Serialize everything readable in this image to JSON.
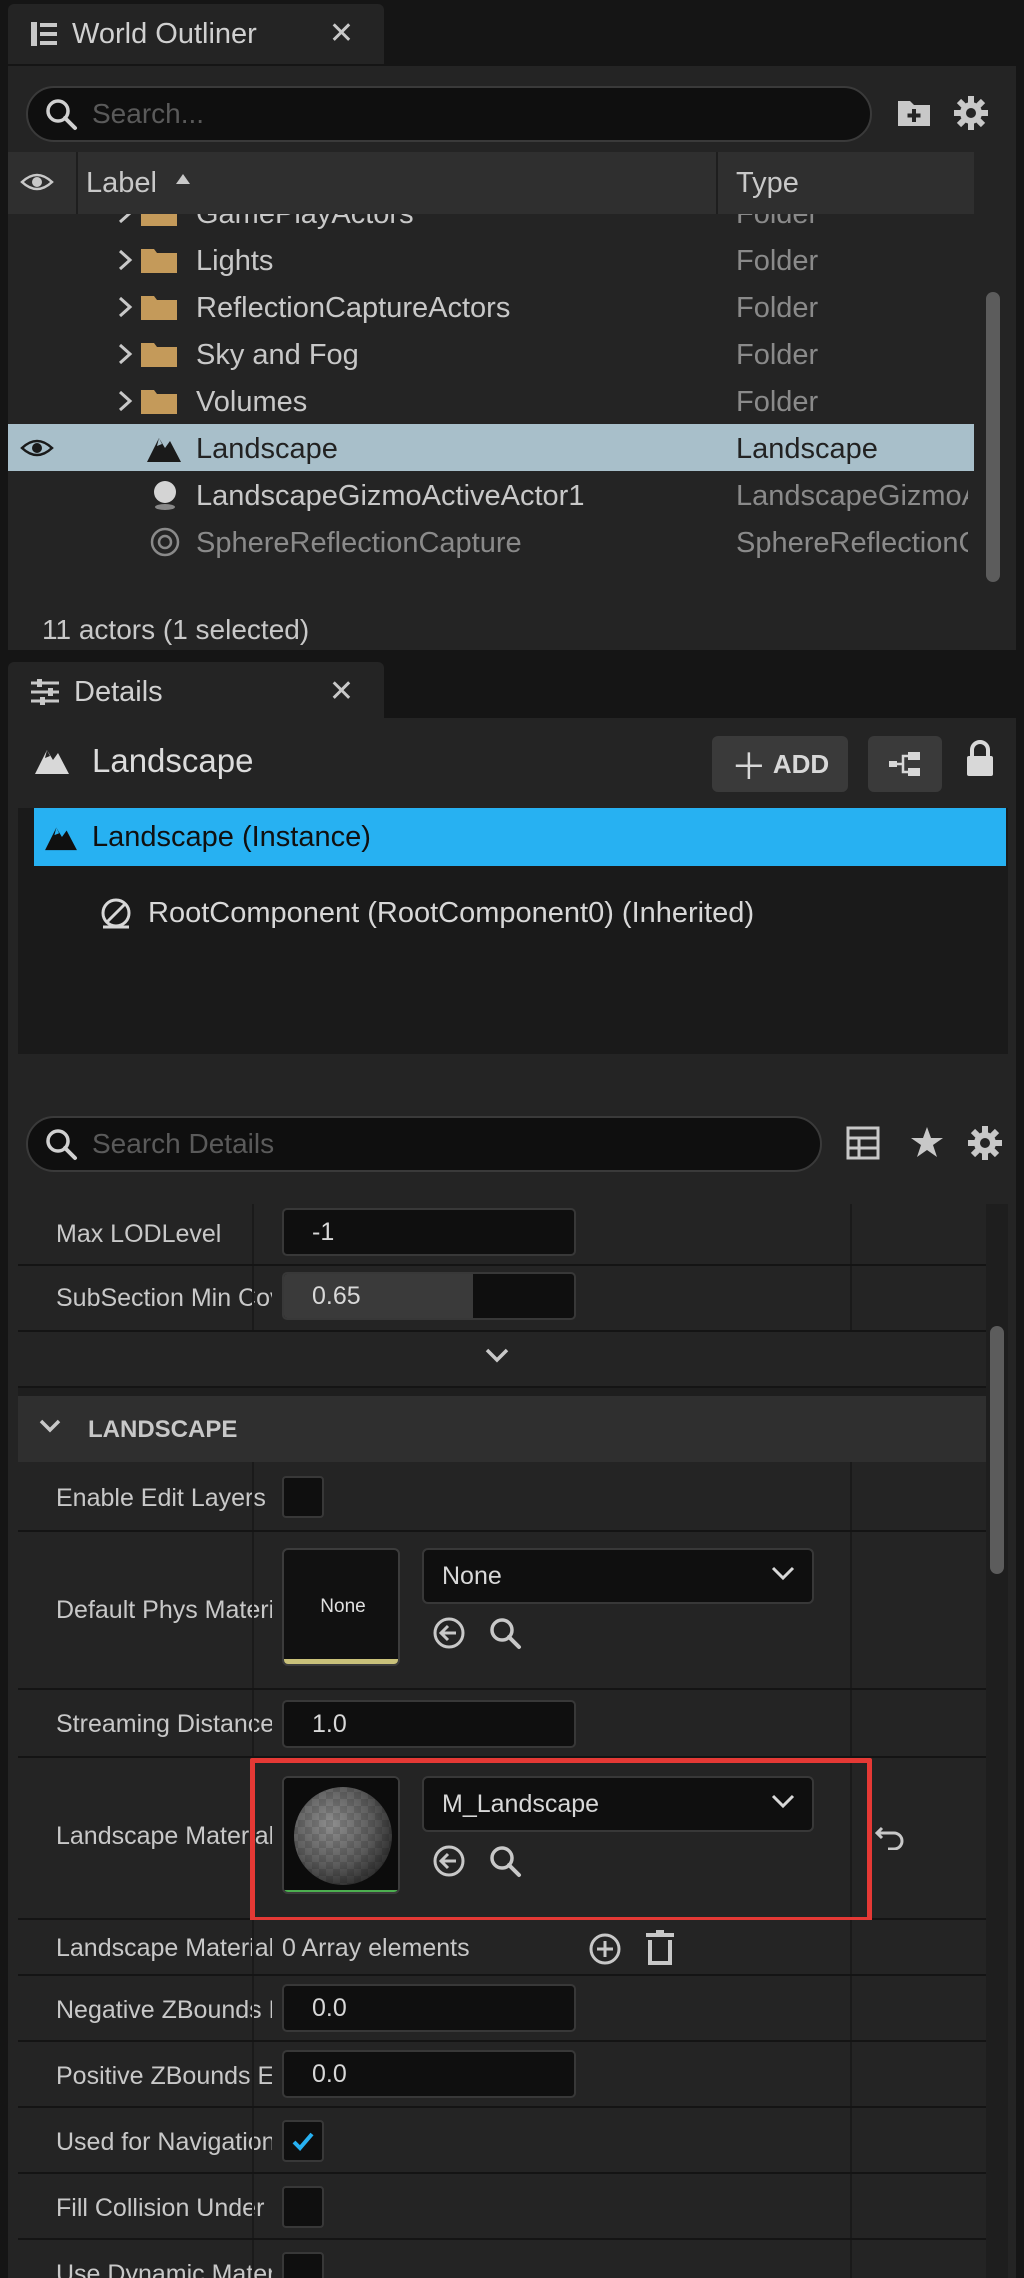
{
  "outliner": {
    "tab_title": "World Outliner",
    "search_placeholder": "Search...",
    "col_label": "Label",
    "col_type": "Type",
    "rows": [
      {
        "label": "GamePlayActors",
        "type": "Folder",
        "kind": "folder"
      },
      {
        "label": "Lights",
        "type": "Folder",
        "kind": "folder"
      },
      {
        "label": "ReflectionCaptureActors",
        "type": "Folder",
        "kind": "folder"
      },
      {
        "label": "Sky and Fog",
        "type": "Folder",
        "kind": "folder"
      },
      {
        "label": "Volumes",
        "type": "Folder",
        "kind": "folder"
      },
      {
        "label": "Landscape",
        "type": "Landscape",
        "kind": "landscape",
        "selected": true
      },
      {
        "label": "LandscapeGizmoActiveActor1",
        "type": "LandscapeGizmoActiveActor",
        "kind": "sphere"
      },
      {
        "label": "SphereReflectionCapture",
        "type": "SphereReflectionCapture",
        "kind": "capture"
      }
    ],
    "status": "11 actors (1 selected)"
  },
  "details": {
    "tab_title": "Details",
    "actor_name": "Landscape",
    "add_label": "ADD",
    "components": [
      {
        "label": "Landscape (Instance)",
        "selected": true
      },
      {
        "label": "RootComponent (RootComponent0) (Inherited)",
        "selected": false
      }
    ],
    "search_placeholder": "Search Details",
    "props_top": [
      {
        "name": "Max LODLevel",
        "value": "-1"
      },
      {
        "name": "SubSection Min Coverage",
        "value": "0.65",
        "fraction": 0.65
      }
    ],
    "section_title": "LANDSCAPE",
    "props": {
      "enable_edit_layers": {
        "name": "Enable Edit Layers",
        "checked": false
      },
      "default_phys_material": {
        "name": "Default Phys Material",
        "thumb_text": "None",
        "value": "None"
      },
      "streaming_distance": {
        "name": "Streaming Distance Multiplier",
        "value": "1.0"
      },
      "landscape_material": {
        "name": "Landscape Material",
        "value": "M_Landscape"
      },
      "landscape_material_overrides": {
        "name": "Landscape Material Override",
        "value": "0 Array elements"
      },
      "negative_zbounds": {
        "name": "Negative ZBounds Extension",
        "value": "0.0"
      },
      "positive_zbounds": {
        "name": "Positive ZBounds Extension",
        "value": "0.0"
      },
      "used_for_navigation": {
        "name": "Used for Navigation",
        "checked": true
      },
      "fill_collision": {
        "name": "Fill Collision Under Landscape",
        "checked": false
      },
      "use_dynamic_material": {
        "name": "Use Dynamic Material Instance",
        "checked": false
      }
    }
  },
  "colors": {
    "selection_blue": "#27b1f2",
    "outliner_selected": "#a8bfca",
    "highlight_red": "#e53935",
    "folder": "#c49a5a",
    "material_bar": "#4caf50",
    "phys_bar": "#c9c17a"
  }
}
